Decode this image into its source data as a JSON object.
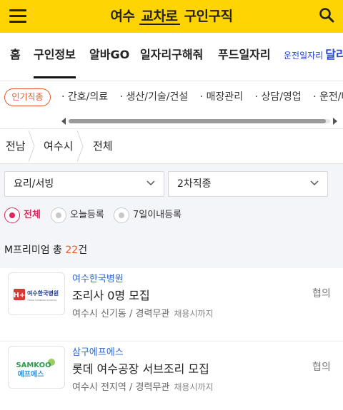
{
  "header": {
    "logo_left": "여수",
    "logo_brand": "교차로",
    "logo_right": "구인구직",
    "bg_color": "#ffd400"
  },
  "icons": {
    "menu": "hamburger-menu-icon",
    "search": "search-icon",
    "chevron": "chevron-down-icon",
    "breadcrumb_separator": "chevron-right-icon"
  },
  "nav": {
    "items": [
      {
        "label": "홈"
      },
      {
        "label": "구인정보"
      },
      {
        "label": "알바GO"
      },
      {
        "label": "일자리구해줘"
      },
      {
        "label": "푸드일자리"
      }
    ],
    "active_index": 1,
    "extra_small": "운전일자리",
    "extra_big": "달리"
  },
  "popular": {
    "badge": "인기직종",
    "items": [
      "· 간호/의료",
      "· 생산/기술/건설",
      "· 매장관리",
      "· 상담/영업",
      "· 운전/배달"
    ]
  },
  "breadcrumb": {
    "items": [
      "전남",
      "여수시",
      "전체"
    ]
  },
  "filters": {
    "select1": "요리/서빙",
    "select2": "2차직종",
    "radios": [
      {
        "label": "전체",
        "checked": true
      },
      {
        "label": "오늘등록",
        "checked": false
      },
      {
        "label": "7일이내등록",
        "checked": false
      }
    ]
  },
  "premium": {
    "prefix": "M프리미엄 총 ",
    "count": "22",
    "suffix": "건",
    "count_color": "#e85a2e"
  },
  "jobs": [
    {
      "company": "여수한국병원",
      "title": "조리사 0명 모집",
      "meta": "여수시 신기동 / 경력무관",
      "deadline": "채용시까지",
      "pay": "협의",
      "logo_mark": "H+",
      "logo_name": "여수한국병원",
      "logo_sub": "YEOSU HANKOOK HOSPITAL"
    },
    {
      "company": "삼구에프에스",
      "title": "롯데 여수공장 서브조리 모집",
      "meta": "여수시 전지역 / 경력무관",
      "deadline": "채용시까지",
      "pay": "협의",
      "logo_mark": "SAMKOO",
      "logo_name": "에프에스"
    }
  ],
  "colors": {
    "accent_red": "#e0245e",
    "link_blue": "#2f66c7",
    "badge_orange": "#e85a2e"
  }
}
